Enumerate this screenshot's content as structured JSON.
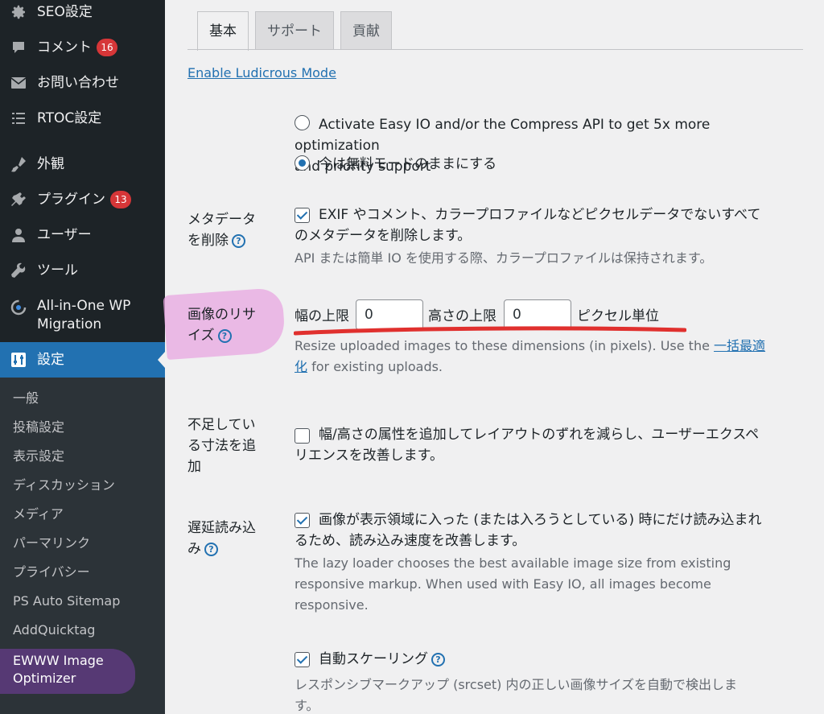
{
  "sidebar": {
    "menu": [
      {
        "label": "SEO設定",
        "icon": "gear-icon"
      },
      {
        "label": "コメント",
        "badge": "16",
        "icon": "comment-icon"
      },
      {
        "label": "お問い合わせ",
        "icon": "mail-icon"
      },
      {
        "label": "RTOC設定",
        "icon": "list-icon"
      },
      {
        "label": "外観",
        "icon": "brush-icon"
      },
      {
        "label": "プラグイン",
        "badge": "13",
        "icon": "plugin-icon"
      },
      {
        "label": "ユーザー",
        "icon": "user-icon"
      },
      {
        "label": "ツール",
        "icon": "wrench-icon"
      },
      {
        "label": "All-in-One WP",
        "label2": "Migration",
        "icon": "migration-icon"
      },
      {
        "label": "設定",
        "icon": "settings-icon"
      }
    ],
    "submenu": [
      "一般",
      "投稿設定",
      "表示設定",
      "ディスカッション",
      "メディア",
      "パーマリンク",
      "プライバシー",
      "PS Auto Sitemap",
      "AddQuicktag",
      "EWWW Image",
      "Optimizer"
    ]
  },
  "tabs": [
    "基本",
    "サポート",
    "貢献"
  ],
  "ludicrous_link": "Enable Ludicrous Mode",
  "easyio": {
    "option1_line1": "Activate Easy IO and/or the Compress API to get 5x more optimization",
    "option1_line2": "and priority support",
    "option2": "今は無料モードのままにする"
  },
  "metadata": {
    "label1": "メタデータ",
    "label2": "を削除",
    "text1": "EXIF やコメント、カラープロファイルなどピクセルデータでないすべて",
    "text2": "のメタデータを削除します。",
    "desc": "API または簡単 IO を使用する際、カラープロファイルは保持されます。"
  },
  "resize": {
    "label1": "画像のリサ",
    "label2": "イズ",
    "width_label": "幅の上限",
    "width_value": "0",
    "height_label": "高さの上限",
    "height_value": "0",
    "unit": "ピクセル単位",
    "desc1": "Resize uploaded images to these dimensions (in pixels). Use the",
    "desc_link1": "一括最適",
    "desc_link2": "化",
    "desc2": " for existing uploads."
  },
  "dimensions": {
    "label1": "不足してい",
    "label2": "る寸法を追",
    "label3": "加",
    "text1": "幅/高さの属性を追加してレイアウトのずれを減らし、ユーザーエクスペ",
    "text2": "リエンスを改善します。"
  },
  "lazy": {
    "label1": "遅延読み込",
    "label2": "み",
    "text1": "画像が表示領域に入った (または入ろうとしている) 時にだけ読み込まれ",
    "text2": "るため、読み込み速度を改善します。",
    "desc1": "The lazy loader chooses the best available image size from existing",
    "desc2": "responsive markup. When used with Easy IO, all images become",
    "desc3": "responsive."
  },
  "autoscale": {
    "label": "自動スケーリング",
    "desc1": "レスポンシブマークアップ (srcset) 内の正しい画像サイズを自動で検出しま",
    "desc2": "す。"
  }
}
